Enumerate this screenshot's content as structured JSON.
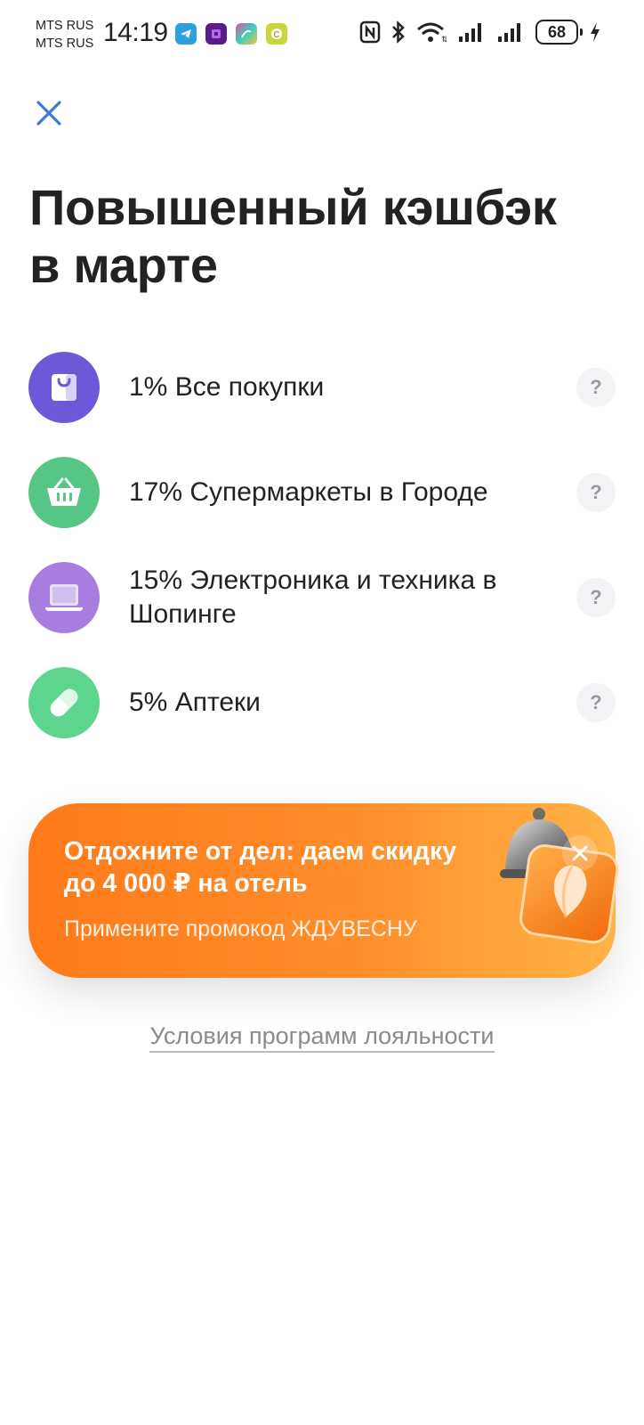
{
  "status_bar": {
    "carrier_1": "MTS RUS",
    "carrier_2": "MTS RUS",
    "time": "14:19",
    "battery": "68",
    "notification_icons": [
      "telegram-icon",
      "purple-app-icon",
      "colorful-app-icon",
      "yellow-c-app-icon"
    ],
    "system_icons": [
      "nfc-icon",
      "bluetooth-icon",
      "wifi-icon",
      "signal-icon",
      "signal-icon",
      "battery-icon",
      "charging-icon"
    ]
  },
  "header": {
    "close_icon": "close-icon",
    "title_line1": "Повышенный кэшбэк",
    "title_line2": "в марте"
  },
  "cashback": {
    "items": [
      {
        "label": "1% Все покупки",
        "icon": "shopping-bag-icon",
        "color": "#6e58d8"
      },
      {
        "label": "17% Супермаркеты в Городе",
        "icon": "basket-icon",
        "color": "#57c585"
      },
      {
        "label": "15% Электроника и техника в Шопинге",
        "icon": "laptop-icon",
        "color": "#a77de0"
      },
      {
        "label": "5% Аптеки",
        "icon": "pill-icon",
        "color": "#5dd58e"
      }
    ],
    "help_label": "?"
  },
  "promo": {
    "title": "Отдохните от дел: даем скидку до 4 000 ₽ на отель",
    "subtitle": "Примените промокод ЖДУВЕСНУ",
    "colors": {
      "start": "#ff7a1a",
      "end": "#ffb347"
    }
  },
  "footer": {
    "loyalty_link": "Условия программ лояльности"
  }
}
